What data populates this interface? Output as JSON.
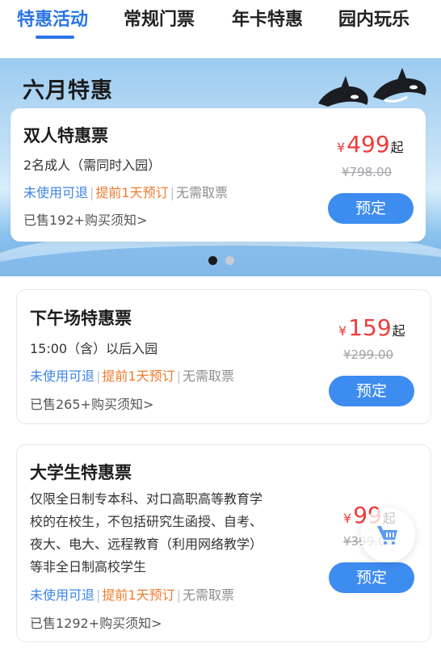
{
  "tabs": [
    {
      "label": "特惠活动",
      "active": true
    },
    {
      "label": "常规门票",
      "active": false
    },
    {
      "label": "年卡特惠",
      "active": false
    },
    {
      "label": "园内玩乐",
      "active": false
    }
  ],
  "banner": {
    "title": "六月特惠",
    "carousel_total": 2,
    "carousel_current": 1
  },
  "tickets": [
    {
      "title": "双人特惠票",
      "desc": "2名成人（需同时入园）",
      "tags": [
        "未使用可退",
        "提前1天预订",
        "无需取票"
      ],
      "sold": "已售192+购买须知>",
      "currency": "¥",
      "price": "499",
      "price_suffix": "起",
      "original_price": "¥798.00",
      "button": "预定"
    },
    {
      "title": "下午场特惠票",
      "desc": "15:00（含）以后入园",
      "tags": [
        "未使用可退",
        "提前1天预订",
        "无需取票"
      ],
      "sold": "已售265+购买须知>",
      "currency": "¥",
      "price": "159",
      "price_suffix": "起",
      "original_price": "¥299.00",
      "button": "预定"
    },
    {
      "title": "大学生特惠票",
      "desc_lines": [
        "仅限全日制专本科、对口高职高等教育学",
        "校的在校生，不包括研究生函授、自考、",
        "夜大、电大、远程教育（利用网络教学）",
        "等非全日制高校学生"
      ],
      "tags": [
        "未使用可退",
        "提前1天预订",
        "无需取票"
      ],
      "sold": "已售1292+购买须知>",
      "currency": "¥",
      "price": "99",
      "price_suffix": "起",
      "original_price": "¥399.00",
      "button": "预定"
    }
  ],
  "colors": {
    "accent": "#2b74e8",
    "price": "#ef3c3c",
    "button": "#3d8cf0",
    "tag_blue": "#3b84e6",
    "tag_orange": "#f07b2d",
    "tag_gray": "#8d8d92"
  },
  "floating": {
    "icon": "shopping-cart-icon"
  }
}
